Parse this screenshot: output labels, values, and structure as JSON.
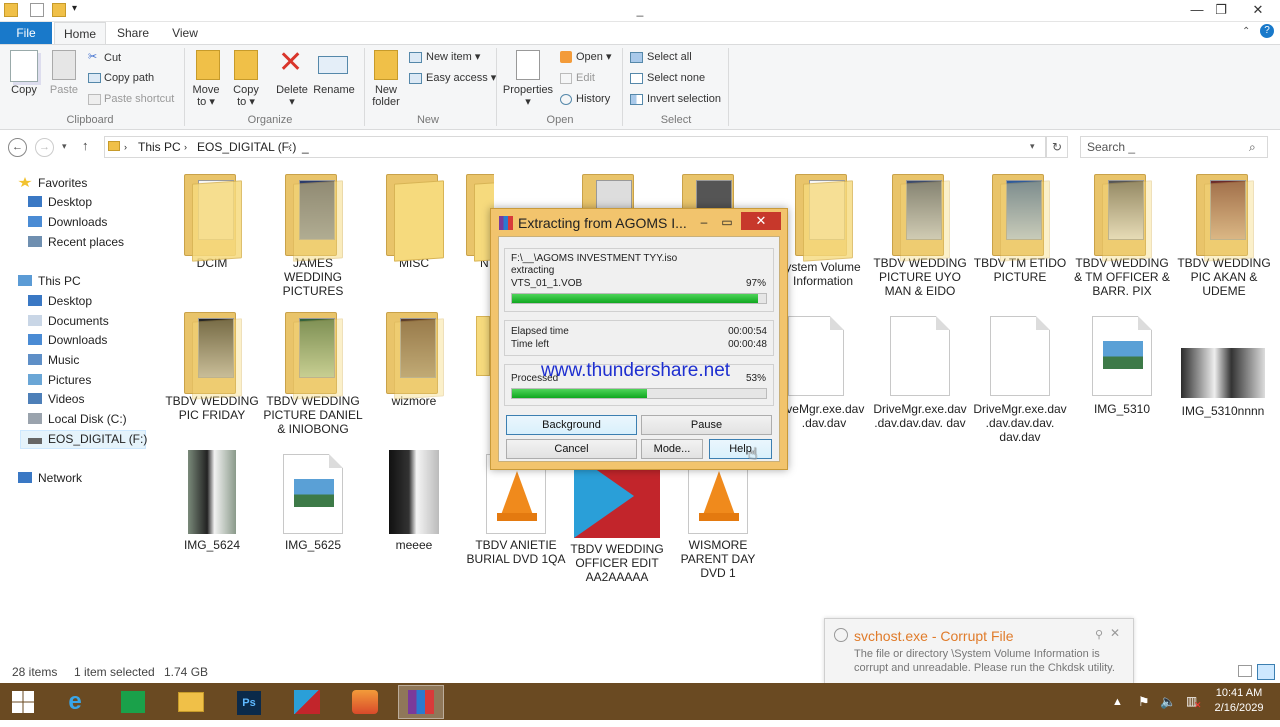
{
  "window": {
    "title": "_",
    "minimize": "—",
    "maximize": "❐",
    "close": "✕"
  },
  "tabs": {
    "file": "File",
    "home": "Home",
    "share": "Share",
    "view": "View"
  },
  "ribbon": {
    "copy": "Copy",
    "paste": "Paste",
    "cut": "Cut",
    "copy_path": "Copy path",
    "paste_shortcut": "Paste shortcut",
    "clipboard_group": "Clipboard",
    "move_to": "Move",
    "move_to2": "to ▾",
    "copy_to": "Copy",
    "copy_to2": "to ▾",
    "delete": "Delete",
    "delete2": "▾",
    "rename": "Rename",
    "organize_group": "Organize",
    "new_folder": "New",
    "new_folder2": "folder",
    "new_item": "New item ▾",
    "easy_access": "Easy access ▾",
    "new_group": "New",
    "properties": "Properties",
    "properties2": "▾",
    "open": "Open ▾",
    "edit": "Edit",
    "history": "History",
    "open_group": "Open",
    "select_all": "Select all",
    "select_none": "Select none",
    "invert_selection": "Invert selection",
    "select_group": "Select"
  },
  "address": {
    "crumbs": [
      "This PC",
      "EOS_DIGITAL (F:)",
      "_"
    ],
    "search_placeholder": "Search _"
  },
  "nav": {
    "favorites": "Favorites",
    "desktop": "Desktop",
    "downloads": "Downloads",
    "recent": "Recent places",
    "thispc": "This PC",
    "pc_desktop": "Desktop",
    "documents": "Documents",
    "pc_downloads": "Downloads",
    "music": "Music",
    "pictures": "Pictures",
    "videos": "Videos",
    "local_disk": "Local Disk (C:)",
    "eos": "EOS_DIGITAL (F:)",
    "network": "Network"
  },
  "items": {
    "r1": [
      "DCIM",
      "JAMES WEDDING PICTURES",
      "MISC",
      "N",
      "",
      "",
      "ystem Volume Information",
      "TBDV  WEDDING PICTURE  UYO MAN & EIDO",
      "TBDV TM ETIDO PICTURE",
      "TBDV WEDDING & TM OFFICER & BARR. PIX",
      "TBDV WEDDING PIC AKAN & UDEME"
    ],
    "r2": [
      "TBDV WEDDING PIC FRIDAY",
      "TBDV WEDDING PICTURE DANIEL & INIOBONG",
      "wizmore",
      "",
      "",
      "",
      "iveMgr.exe.dav .dav.dav",
      "DriveMgr.exe.dav .dav.dav.dav. dav",
      "DriveMgr.exe.dav .dav.dav.dav. dav.dav",
      "IMG_5310",
      "IMG_5310nnnn"
    ],
    "r3": [
      "IMG_5624",
      "IMG_5625",
      "meeee",
      "TBDV ANIETIE BURIAL DVD 1QA",
      "TBDV WEDDING OFFICER EDIT AA2AAAAA",
      "WISMORE PARENT DAY DVD 1"
    ]
  },
  "dialog": {
    "title": "Extracting from AGOMS I...",
    "path": "F:\\__\\AGOMS INVESTMENT TYY.iso",
    "action": "extracting",
    "file": "VTS_01_1.VOB",
    "file_pct": "97%",
    "file_progress": 0.97,
    "elapsed_label": "Elapsed time",
    "elapsed": "00:00:54",
    "left_label": "Time left",
    "left": "00:00:48",
    "processed_label": "Processed",
    "processed_pct": "53%",
    "processed_progress": 0.53,
    "background": "Background",
    "pause": "Pause",
    "cancel": "Cancel",
    "mode": "Mode...",
    "help": "Help"
  },
  "watermark": "www.thundershare.net",
  "status": {
    "count": "28 items",
    "selected": "1 item selected",
    "size": "1.74 GB"
  },
  "notification": {
    "title": "svchost.exe - Corrupt File",
    "body1": "The file or directory \\System Volume Information is",
    "body2": "corrupt and unreadable. Please run the Chkdsk utility."
  },
  "taskbar": {
    "time": "10:41 AM",
    "date": "2/16/2029"
  },
  "colors": {
    "accent": "#1979ca",
    "taskbar": "#6a4a22",
    "progress": "#12b020",
    "dialog_frame": "#f2c46d",
    "notif_title": "#e07b2a"
  }
}
